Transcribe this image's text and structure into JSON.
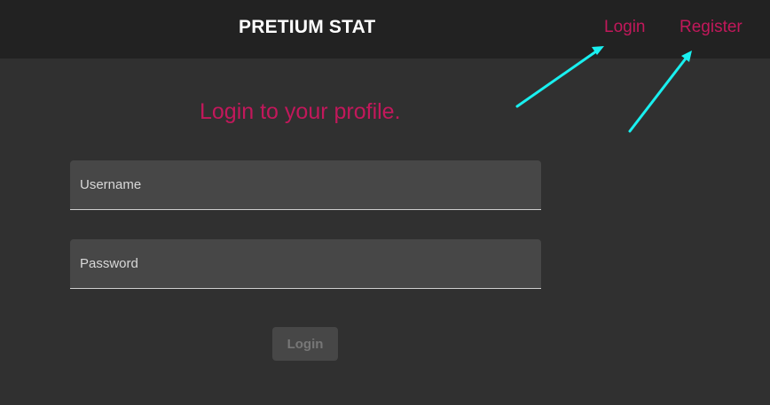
{
  "header": {
    "brand": "PRETIUM STAT",
    "nav": {
      "login": "Login",
      "register": "Register"
    }
  },
  "form": {
    "heading": "Login to your profile.",
    "username_placeholder": "Username",
    "password_placeholder": "Password",
    "submit_label": "Login"
  },
  "colors": {
    "accent": "#c2185b",
    "header_bg": "#222222",
    "page_bg": "#303030",
    "field_bg": "#474747",
    "annotation_arrow": "#19f0f0"
  },
  "icons": {
    "annotation": "arrow-icon"
  }
}
